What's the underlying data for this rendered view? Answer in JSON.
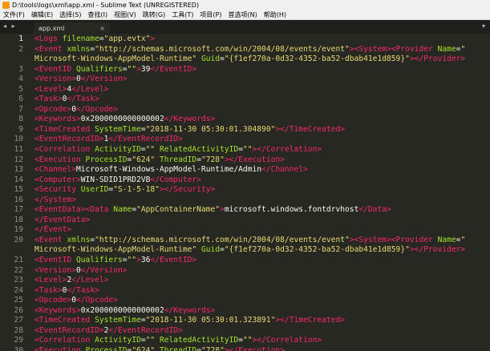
{
  "window": {
    "title": "D:\\tools\\logs\\xml\\app.xml - Sublime Text (UNREGISTERED)"
  },
  "menu": [
    {
      "label": "文件(F)"
    },
    {
      "label": "编辑(E)"
    },
    {
      "label": "选择(S)"
    },
    {
      "label": "查找(I)"
    },
    {
      "label": "视图(V)"
    },
    {
      "label": "跳转(G)"
    },
    {
      "label": "工具(T)"
    },
    {
      "label": "项目(P)"
    },
    {
      "label": "首选项(N)"
    },
    {
      "label": "帮助(H)"
    }
  ],
  "tabbar": {
    "prev": "◂",
    "next": "▸",
    "menu": "▾"
  },
  "tab": {
    "label": "app.xml",
    "close": "×"
  },
  "editor": {
    "lines": [
      {
        "n": "1",
        "active": true,
        "p": [
          [
            "t",
            "<Logs "
          ],
          [
            "a",
            "filename"
          ],
          [
            "p",
            "="
          ],
          [
            "s",
            "\"app.evtx\""
          ],
          [
            "t",
            ">"
          ]
        ]
      },
      {
        "n": "2",
        "p": [
          [
            "t",
            "<Event "
          ],
          [
            "a",
            "xmlns"
          ],
          [
            "p",
            "="
          ],
          [
            "s",
            "\"http://schemas.microsoft.com/win/2004/08/events/event\""
          ],
          [
            "t",
            ">"
          ],
          [
            "t",
            "<System>"
          ],
          [
            "t",
            "<Provider "
          ],
          [
            "a",
            "Name"
          ],
          [
            "p",
            "="
          ],
          [
            "s",
            "\""
          ]
        ]
      },
      {
        "n": "",
        "p": [
          [
            "s",
            "Microsoft-Windows-AppModel-Runtime\""
          ],
          [
            "p",
            " "
          ],
          [
            "a",
            "Guid"
          ],
          [
            "p",
            "="
          ],
          [
            "s",
            "\"{f1ef270a-0d32-4352-ba52-dbab41e1d859}\""
          ],
          [
            "t",
            "></Provider>"
          ]
        ]
      },
      {
        "n": "3",
        "p": [
          [
            "t",
            "<EventID "
          ],
          [
            "a",
            "Qualifiers"
          ],
          [
            "p",
            "="
          ],
          [
            "s",
            "\"\""
          ],
          [
            "t",
            ">"
          ],
          [
            "p",
            "39"
          ],
          [
            "t",
            "</EventID>"
          ]
        ]
      },
      {
        "n": "4",
        "p": [
          [
            "t",
            "<Version>"
          ],
          [
            "p",
            "0"
          ],
          [
            "t",
            "</Version>"
          ]
        ]
      },
      {
        "n": "5",
        "p": [
          [
            "t",
            "<Level>"
          ],
          [
            "p",
            "4"
          ],
          [
            "t",
            "</Level>"
          ]
        ]
      },
      {
        "n": "6",
        "p": [
          [
            "t",
            "<Task>"
          ],
          [
            "p",
            "0"
          ],
          [
            "t",
            "</Task>"
          ]
        ]
      },
      {
        "n": "7",
        "p": [
          [
            "t",
            "<Opcode>"
          ],
          [
            "p",
            "0"
          ],
          [
            "t",
            "</Opcode>"
          ]
        ]
      },
      {
        "n": "8",
        "p": [
          [
            "t",
            "<Keywords>"
          ],
          [
            "p",
            "0x2000000000000002"
          ],
          [
            "t",
            "</Keywords>"
          ]
        ]
      },
      {
        "n": "9",
        "p": [
          [
            "t",
            "<TimeCreated "
          ],
          [
            "a",
            "SystemTime"
          ],
          [
            "p",
            "="
          ],
          [
            "s",
            "\"2018-11-30 05:30:01.304890\""
          ],
          [
            "t",
            "></TimeCreated>"
          ]
        ]
      },
      {
        "n": "10",
        "p": [
          [
            "t",
            "<EventRecordID>"
          ],
          [
            "p",
            "1"
          ],
          [
            "t",
            "</EventRecordID>"
          ]
        ]
      },
      {
        "n": "11",
        "p": [
          [
            "t",
            "<Correlation "
          ],
          [
            "a",
            "ActivityID"
          ],
          [
            "p",
            "="
          ],
          [
            "s",
            "\"\""
          ],
          [
            "p",
            " "
          ],
          [
            "a",
            "RelatedActivityID"
          ],
          [
            "p",
            "="
          ],
          [
            "s",
            "\"\""
          ],
          [
            "t",
            "></Correlation>"
          ]
        ]
      },
      {
        "n": "12",
        "p": [
          [
            "t",
            "<Execution "
          ],
          [
            "a",
            "ProcessID"
          ],
          [
            "p",
            "="
          ],
          [
            "s",
            "\"624\""
          ],
          [
            "p",
            " "
          ],
          [
            "a",
            "ThreadID"
          ],
          [
            "p",
            "="
          ],
          [
            "s",
            "\"728\""
          ],
          [
            "t",
            "></Execution>"
          ]
        ]
      },
      {
        "n": "13",
        "p": [
          [
            "t",
            "<Channel>"
          ],
          [
            "p",
            "Microsoft-Windows-AppModel-Runtime/Admin"
          ],
          [
            "t",
            "</Channel>"
          ]
        ]
      },
      {
        "n": "14",
        "p": [
          [
            "t",
            "<Computer>"
          ],
          [
            "p",
            "WIN-SDID1PRD2VB"
          ],
          [
            "t",
            "</Computer>"
          ]
        ]
      },
      {
        "n": "15",
        "p": [
          [
            "t",
            "<Security "
          ],
          [
            "a",
            "UserID"
          ],
          [
            "p",
            "="
          ],
          [
            "s",
            "\"S-1-5-18\""
          ],
          [
            "t",
            "></Security>"
          ]
        ]
      },
      {
        "n": "16",
        "p": [
          [
            "t",
            "</System>"
          ]
        ]
      },
      {
        "n": "17",
        "p": [
          [
            "t",
            "<EventData>"
          ],
          [
            "t",
            "<Data "
          ],
          [
            "a",
            "Name"
          ],
          [
            "p",
            "="
          ],
          [
            "s",
            "\"AppContainerName\""
          ],
          [
            "t",
            ">"
          ],
          [
            "p",
            "microsoft.windows.fontdrvhost"
          ],
          [
            "t",
            "</Data>"
          ]
        ]
      },
      {
        "n": "18",
        "p": [
          [
            "t",
            "</EventData>"
          ]
        ]
      },
      {
        "n": "19",
        "p": [
          [
            "t",
            "</Event>"
          ]
        ]
      },
      {
        "n": "20",
        "p": [
          [
            "t",
            "<Event "
          ],
          [
            "a",
            "xmlns"
          ],
          [
            "p",
            "="
          ],
          [
            "s",
            "\"http://schemas.microsoft.com/win/2004/08/events/event\""
          ],
          [
            "t",
            ">"
          ],
          [
            "t",
            "<System>"
          ],
          [
            "t",
            "<Provider "
          ],
          [
            "a",
            "Name"
          ],
          [
            "p",
            "="
          ],
          [
            "s",
            "\""
          ]
        ]
      },
      {
        "n": "",
        "p": [
          [
            "s",
            "Microsoft-Windows-AppModel-Runtime\""
          ],
          [
            "p",
            " "
          ],
          [
            "a",
            "Guid"
          ],
          [
            "p",
            "="
          ],
          [
            "s",
            "\"{f1ef270a-0d32-4352-ba52-dbab41e1d859}\""
          ],
          [
            "t",
            "></Provider>"
          ]
        ]
      },
      {
        "n": "21",
        "p": [
          [
            "t",
            "<EventID "
          ],
          [
            "a",
            "Qualifiers"
          ],
          [
            "p",
            "="
          ],
          [
            "s",
            "\"\""
          ],
          [
            "t",
            ">"
          ],
          [
            "p",
            "36"
          ],
          [
            "t",
            "</EventID>"
          ]
        ]
      },
      {
        "n": "22",
        "p": [
          [
            "t",
            "<Version>"
          ],
          [
            "p",
            "0"
          ],
          [
            "t",
            "</Version>"
          ]
        ]
      },
      {
        "n": "23",
        "p": [
          [
            "t",
            "<Level>"
          ],
          [
            "p",
            "2"
          ],
          [
            "t",
            "</Level>"
          ]
        ]
      },
      {
        "n": "24",
        "p": [
          [
            "t",
            "<Task>"
          ],
          [
            "p",
            "0"
          ],
          [
            "t",
            "</Task>"
          ]
        ]
      },
      {
        "n": "25",
        "p": [
          [
            "t",
            "<Opcode>"
          ],
          [
            "p",
            "0"
          ],
          [
            "t",
            "</Opcode>"
          ]
        ]
      },
      {
        "n": "26",
        "p": [
          [
            "t",
            "<Keywords>"
          ],
          [
            "p",
            "0x2000000000000002"
          ],
          [
            "t",
            "</Keywords>"
          ]
        ]
      },
      {
        "n": "27",
        "p": [
          [
            "t",
            "<TimeCreated "
          ],
          [
            "a",
            "SystemTime"
          ],
          [
            "p",
            "="
          ],
          [
            "s",
            "\"2018-11-30 05:30:01.323891\""
          ],
          [
            "t",
            "></TimeCreated>"
          ]
        ]
      },
      {
        "n": "28",
        "p": [
          [
            "t",
            "<EventRecordID>"
          ],
          [
            "p",
            "2"
          ],
          [
            "t",
            "</EventRecordID>"
          ]
        ]
      },
      {
        "n": "29",
        "p": [
          [
            "t",
            "<Correlation "
          ],
          [
            "a",
            "ActivityID"
          ],
          [
            "p",
            "="
          ],
          [
            "s",
            "\"\""
          ],
          [
            "p",
            " "
          ],
          [
            "a",
            "RelatedActivityID"
          ],
          [
            "p",
            "="
          ],
          [
            "s",
            "\"\""
          ],
          [
            "t",
            "></Correlation>"
          ]
        ]
      },
      {
        "n": "30",
        "p": [
          [
            "t",
            "<Execution "
          ],
          [
            "a",
            "ProcessID"
          ],
          [
            "p",
            "="
          ],
          [
            "s",
            "\"624\""
          ],
          [
            "p",
            " "
          ],
          [
            "a",
            "ThreadID"
          ],
          [
            "p",
            "="
          ],
          [
            "s",
            "\"728\""
          ],
          [
            "t",
            "></Execution>"
          ]
        ]
      }
    ]
  }
}
